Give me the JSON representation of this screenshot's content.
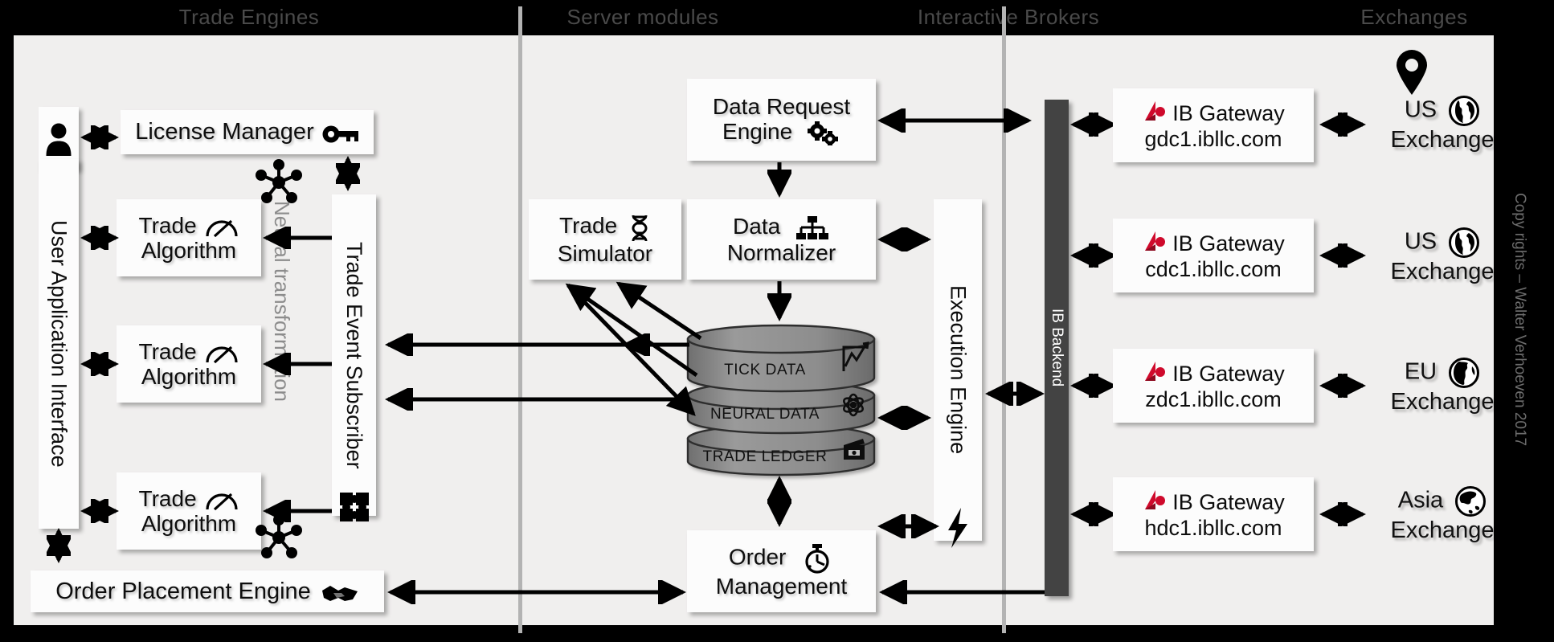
{
  "headers": [
    {
      "label": "Trade Engines"
    },
    {
      "label": "Server modules"
    },
    {
      "label": "Interactive Brokers"
    },
    {
      "label": "Exchanges"
    }
  ],
  "trade_engines": {
    "user_icon": "user-icon",
    "user_application_interface": "User Application Interface",
    "license_manager": "License Manager",
    "license_manager_icon": "key-icon",
    "trade_algorithms": [
      {
        "line1": "Trade",
        "line2": "Algorithm",
        "icon": "gauge-icon"
      },
      {
        "line1": "Trade",
        "line2": "Algorithm",
        "icon": "gauge-icon"
      },
      {
        "line1": "Trade",
        "line2": "Algorithm",
        "icon": "gauge-icon"
      }
    ],
    "neural_transformation": "Neural transformation",
    "neural_icon": "neural-node-icon",
    "trade_event_subscriber": "Trade Event Subscriber",
    "subscriber_icon": "puzzle-icon",
    "order_placement_engine": "Order Placement Engine",
    "order_placement_icon": "handshake-icon"
  },
  "server_modules": {
    "data_request_engine": {
      "line1": "Data Request",
      "line2": "Engine",
      "icon": "gears-icon"
    },
    "trade_simulator": {
      "line1": "Trade",
      "line2": "Simulator",
      "icon": "dna-icon"
    },
    "data_normalizer": {
      "line1": "Data",
      "line2": "Normalizer",
      "icon": "hierarchy-icon"
    },
    "databases": [
      {
        "label": "TICK DATA",
        "icon": "line-chart-icon"
      },
      {
        "label": "NEURAL DATA",
        "icon": "atom-icon"
      },
      {
        "label": "TRADE LEDGER",
        "icon": "wallet-icon"
      }
    ],
    "execution_engine": "Execution Engine",
    "execution_engine_icon": "lightning-icon",
    "order_management": {
      "line1": "Order",
      "line2": "Management",
      "icon": "stopwatch-icon"
    }
  },
  "interactive_brokers": {
    "ib_backend": "IB Backend",
    "gateways": [
      {
        "title": "IB Gateway",
        "host": "gdc1.ibllc.com",
        "logo": "ib-logo-icon"
      },
      {
        "title": "IB Gateway",
        "host": "cdc1.ibllc.com",
        "logo": "ib-logo-icon"
      },
      {
        "title": "IB Gateway",
        "host": "zdc1.ibllc.com",
        "logo": "ib-logo-icon"
      },
      {
        "title": "IB Gateway",
        "host": "hdc1.ibllc.com",
        "logo": "ib-logo-icon"
      }
    ]
  },
  "exchanges": {
    "pin_icon": "map-pin-icon",
    "items": [
      {
        "line1": "US",
        "line2": "Exchange",
        "icon": "globe-americas-icon"
      },
      {
        "line1": "US",
        "line2": "Exchange",
        "icon": "globe-americas-icon"
      },
      {
        "line1": "EU",
        "line2": "Exchange",
        "icon": "globe-europe-icon"
      },
      {
        "line1": "Asia",
        "line2": "Exchange",
        "icon": "globe-asia-icon"
      }
    ]
  },
  "footer": {
    "copyright": "Copy rights – Walter Verhoeven 2017"
  },
  "colors": {
    "background": "#000000",
    "canvas": "#f0efee",
    "box": "#fcfcfc",
    "header_text": "#4a4a4a",
    "neural_text": "#8c8c8c",
    "ib_backend": "#434343",
    "ib_red": "#cf0a2c",
    "db_fill": "#8a8a8a"
  }
}
